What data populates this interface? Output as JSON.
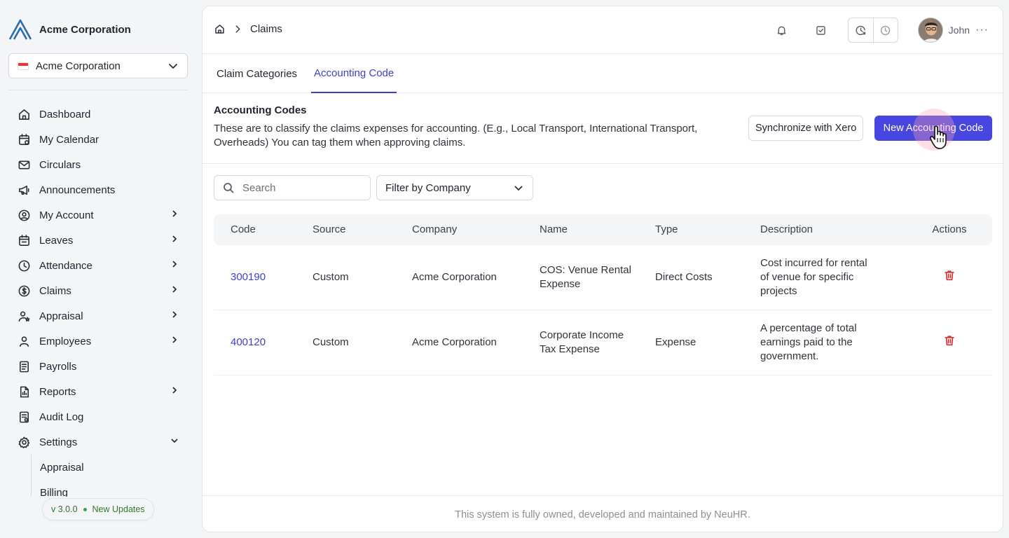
{
  "brand": {
    "name": "Acme Corporation",
    "logo_color": "#2b6cb0"
  },
  "company_select": {
    "value": "Acme Corporation"
  },
  "sidebar": {
    "items": [
      {
        "label": "Dashboard",
        "icon": "home-icon",
        "chevron": false
      },
      {
        "label": "My Calendar",
        "icon": "calendar-icon",
        "chevron": false
      },
      {
        "label": "Circulars",
        "icon": "mail-icon",
        "chevron": false
      },
      {
        "label": "Announcements",
        "icon": "megaphone-icon",
        "chevron": false
      },
      {
        "label": "My Account",
        "icon": "user-circle-icon",
        "chevron": true
      },
      {
        "label": "Leaves",
        "icon": "calendar-leave-icon",
        "chevron": true
      },
      {
        "label": "Attendance",
        "icon": "clock-icon",
        "chevron": true
      },
      {
        "label": "Claims",
        "icon": "dollar-icon",
        "chevron": true
      },
      {
        "label": "Appraisal",
        "icon": "user-star-icon",
        "chevron": true
      },
      {
        "label": "Employees",
        "icon": "user-icon",
        "chevron": true
      },
      {
        "label": "Payrolls",
        "icon": "receipt-icon",
        "chevron": false
      },
      {
        "label": "Reports",
        "icon": "report-icon",
        "chevron": true
      },
      {
        "label": "Audit Log",
        "icon": "log-icon",
        "chevron": false
      },
      {
        "label": "Settings",
        "icon": "gear-icon",
        "chevron": true
      }
    ],
    "settings_sub": [
      "Appraisal",
      "Billing"
    ],
    "version": "v 3.0.0",
    "updates_label": "New Updates"
  },
  "header": {
    "breadcrumb": "Claims",
    "user_name": "John",
    "more": "···"
  },
  "tabs": [
    {
      "label": "Claim Categories",
      "active": false
    },
    {
      "label": "Accounting Code",
      "active": true
    }
  ],
  "section": {
    "title": "Accounting Codes",
    "description": "These are to classify the claims expenses for accounting. (E.g., Local Transport, International Transport, Overheads) You can tag them when approving claims.",
    "sync_label": "Synchronize with Xero",
    "new_label": "New Accounting Code"
  },
  "filters": {
    "search_placeholder": "Search",
    "company_filter": "Filter by Company"
  },
  "table": {
    "columns": [
      "Code",
      "Source",
      "Company",
      "Name",
      "Type",
      "Description",
      "Actions"
    ],
    "rows": [
      {
        "code": "300190",
        "source": "Custom",
        "company": "Acme Corporation",
        "name": "COS: Venue Rental Expense",
        "type": "Direct Costs",
        "description": "Cost incurred for rental of venue for specific projects"
      },
      {
        "code": "400120",
        "source": "Custom",
        "company": "Acme Corporation",
        "name": "Corporate Income Tax Expense",
        "type": "Expense",
        "description": "A percentage of total earnings paid to the government."
      }
    ]
  },
  "footer": {
    "text": "This system is fully owned, developed and maintained by NeuHR."
  },
  "colors": {
    "accent": "#3d3fc6",
    "primary_button": "#4746e0",
    "danger": "#d32f2f"
  }
}
